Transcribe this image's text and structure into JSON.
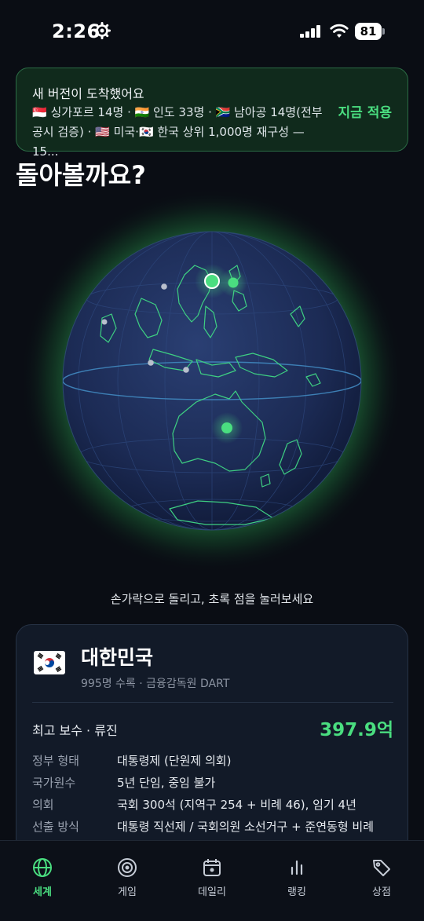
{
  "status": {
    "time": "2:26",
    "battery": "81"
  },
  "banner": {
    "title": "새 버전이 도착했어요",
    "body": "🇸🇬 싱가포르 14명 · 🇮🇳 인도 33명 · 🇿🇦 남아공 14명(전부 공시 검증) · 🇺🇸 미국·🇰🇷 한국 상위 1,000명 재구성 — 15...",
    "apply": "지금 적용"
  },
  "hero": {
    "title": "돌아볼까요?"
  },
  "globe": {
    "hint": "손가락으로 돌리고, 초록 점을 눌러보세요"
  },
  "country": {
    "name": "대한민국",
    "sub": "995명 수록 · 금융감독원 DART",
    "top_pay_label": "최고 보수 · 류진",
    "top_pay_value": "397.9억",
    "rows": [
      {
        "label": "정부 형태",
        "value": "대통령제 (단원제 의회)"
      },
      {
        "label": "국가원수",
        "value": "5년 단임, 중임 불가"
      },
      {
        "label": "의회",
        "value": "국회 300석 (지역구 254 + 비례 46), 임기 4년"
      },
      {
        "label": "선출 방식",
        "value": "대통령 직선제 / 국회의원 소선거구 + 준연동형 비례"
      }
    ]
  },
  "tabs": [
    {
      "label": "세계",
      "icon": "globe-icon",
      "active": true
    },
    {
      "label": "게임",
      "icon": "target-icon",
      "active": false
    },
    {
      "label": "데일리",
      "icon": "calendar-icon",
      "active": false
    },
    {
      "label": "랭킹",
      "icon": "bar-chart-icon",
      "active": false
    },
    {
      "label": "상점",
      "icon": "tag-icon",
      "active": false
    }
  ],
  "colors": {
    "accent": "#4ade80",
    "background": "#0a0d14",
    "card": "#121a28",
    "banner": "#102a1c"
  }
}
